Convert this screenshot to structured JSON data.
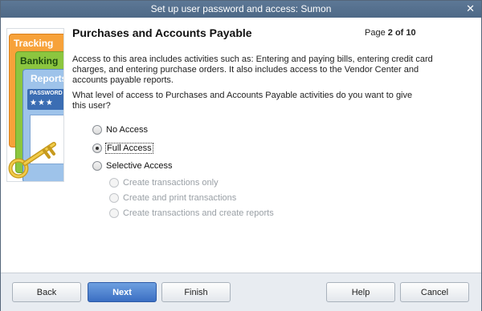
{
  "window": {
    "title": "Set up user password and access: Sumon",
    "close_glyph": "✕"
  },
  "illustration": {
    "tracking_label": "Tracking",
    "banking_label": "Banking",
    "reports_label": "Reports",
    "password_label": "PASSWORD",
    "password_mask": "★★★"
  },
  "header": {
    "title": "Purchases and Accounts Payable",
    "page_prefix": "Page",
    "page_value": "2 of 10"
  },
  "body": {
    "description": "Access to this area includes activities such as: Entering and paying bills, entering credit card charges, and entering purchase orders. It also includes access to the Vendor Center and accounts payable reports.",
    "question": "What level of access to Purchases and Accounts Payable activities do you want to give this user?"
  },
  "options": {
    "no_access": "No Access",
    "full_access": "Full Access",
    "selective_access": "Selective Access",
    "create_only": "Create transactions only",
    "create_print": "Create and print transactions",
    "create_reports": "Create transactions and create reports",
    "selected": "Full Access"
  },
  "buttons": {
    "back": "Back",
    "next": "Next",
    "finish": "Finish",
    "help": "Help",
    "cancel": "Cancel"
  }
}
